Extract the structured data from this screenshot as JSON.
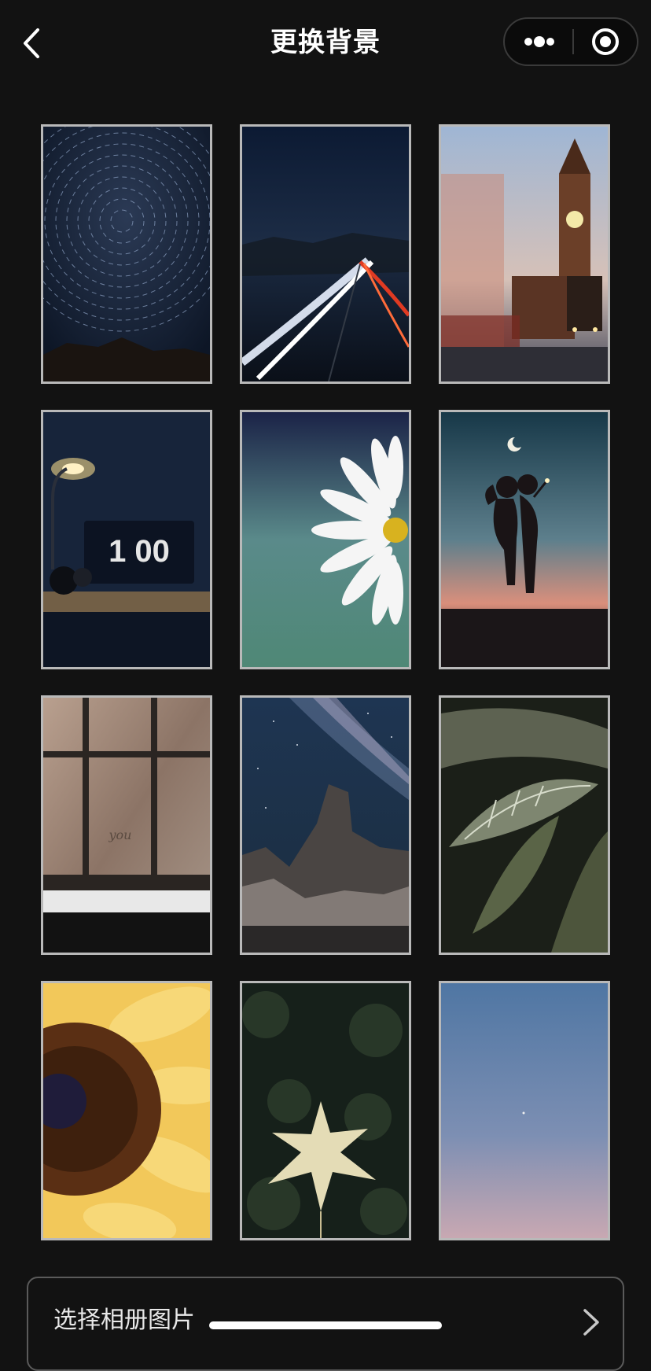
{
  "header": {
    "title": "更换背景",
    "back_icon": "chevron-left-icon",
    "more_icon": "more-dots-icon",
    "close_icon": "target-close-icon"
  },
  "backgrounds": [
    {
      "name": "star-trails"
    },
    {
      "name": "highway-light-trails"
    },
    {
      "name": "big-ben-london"
    },
    {
      "name": "desk-lamp-flip-clock"
    },
    {
      "name": "white-daisy"
    },
    {
      "name": "couple-silhouette-moon"
    },
    {
      "name": "frosted-window"
    },
    {
      "name": "milky-way-mountain"
    },
    {
      "name": "green-leaves"
    },
    {
      "name": "sunflower"
    },
    {
      "name": "maple-leaf"
    },
    {
      "name": "dusk-sky-moon"
    }
  ],
  "clock_text": "1 00",
  "window_writing": "you",
  "album": {
    "label": "选择相册图片",
    "chevron_icon": "chevron-right-icon"
  },
  "colors": {
    "background": "#121212",
    "tile_border": "#b9b9b9"
  }
}
